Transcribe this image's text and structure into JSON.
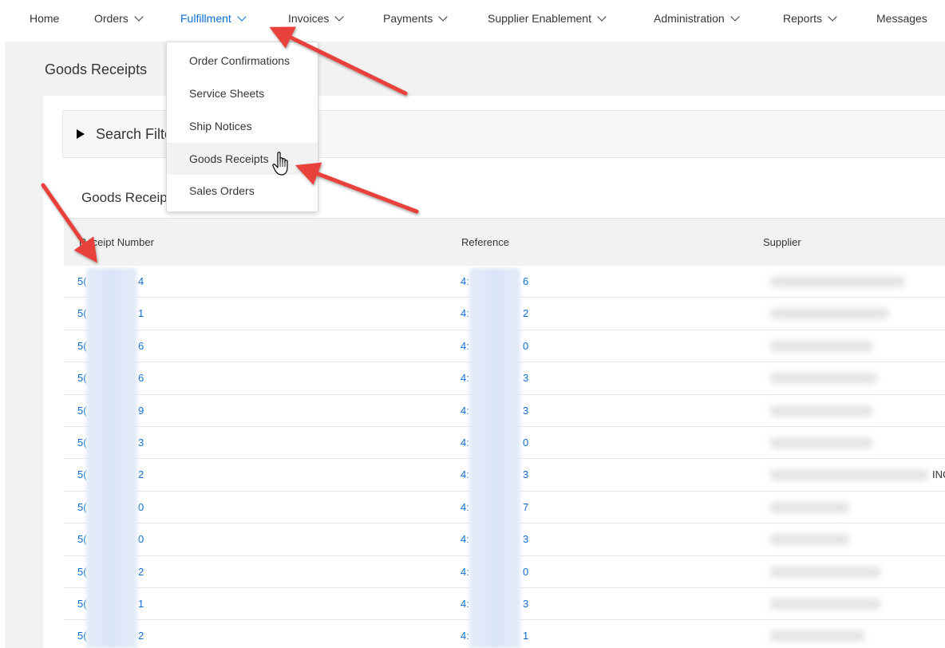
{
  "nav": {
    "items": [
      {
        "label": "Home"
      },
      {
        "label": "Orders"
      },
      {
        "label": "Fulfillment"
      },
      {
        "label": "Invoices"
      },
      {
        "label": "Payments"
      },
      {
        "label": "Supplier Enablement"
      },
      {
        "label": "Administration"
      },
      {
        "label": "Reports"
      },
      {
        "label": "Messages"
      }
    ],
    "active": "Fulfillment"
  },
  "page": {
    "title": "Goods Receipts",
    "filter_label": "Search Filters",
    "table_title": "Goods Receipts"
  },
  "dropdown": {
    "items": [
      {
        "label": "Order Confirmations"
      },
      {
        "label": "Service Sheets"
      },
      {
        "label": "Ship Notices"
      },
      {
        "label": "Goods Receipts"
      },
      {
        "label": "Sales Orders"
      }
    ],
    "hovered": "Goods Receipts"
  },
  "table": {
    "columns": [
      "Receipt Number",
      "Reference",
      "Supplier"
    ],
    "rows": [
      {
        "receipt_prefix": "5(",
        "receipt_suffix": "4",
        "ref_prefix": "4:",
        "ref_suffix": "6"
      },
      {
        "receipt_prefix": "5(",
        "receipt_suffix": "1",
        "ref_prefix": "4:",
        "ref_suffix": "2"
      },
      {
        "receipt_prefix": "5(",
        "receipt_suffix": "6",
        "ref_prefix": "4:",
        "ref_suffix": "0"
      },
      {
        "receipt_prefix": "5(",
        "receipt_suffix": "6",
        "ref_prefix": "4:",
        "ref_suffix": "3"
      },
      {
        "receipt_prefix": "5(",
        "receipt_suffix": "9",
        "ref_prefix": "4:",
        "ref_suffix": "3"
      },
      {
        "receipt_prefix": "5(",
        "receipt_suffix": "3",
        "ref_prefix": "4:",
        "ref_suffix": "0"
      },
      {
        "receipt_prefix": "5(",
        "receipt_suffix": "2",
        "ref_prefix": "4:",
        "ref_suffix": "3",
        "supplier_extra": "INC"
      },
      {
        "receipt_prefix": "5(",
        "receipt_suffix": "0",
        "ref_prefix": "4:",
        "ref_suffix": "7"
      },
      {
        "receipt_prefix": "5(",
        "receipt_suffix": "0",
        "ref_prefix": "4:",
        "ref_suffix": "3"
      },
      {
        "receipt_prefix": "5(",
        "receipt_suffix": "2",
        "ref_prefix": "4:",
        "ref_suffix": "0"
      },
      {
        "receipt_prefix": "5(",
        "receipt_suffix": "1",
        "ref_prefix": "4:",
        "ref_suffix": "3"
      },
      {
        "receipt_prefix": "5(",
        "receipt_suffix": "2",
        "ref_prefix": "4:",
        "ref_suffix": "1"
      }
    ]
  },
  "colors": {
    "link": "#0a6ed1",
    "arrow": "#e8403a",
    "text": "#32363a"
  },
  "icons": {
    "menu_chevron": "chevron-down-icon",
    "filter_toggle": "triangle-right-icon",
    "cursor": "hand-pointer-icon"
  }
}
